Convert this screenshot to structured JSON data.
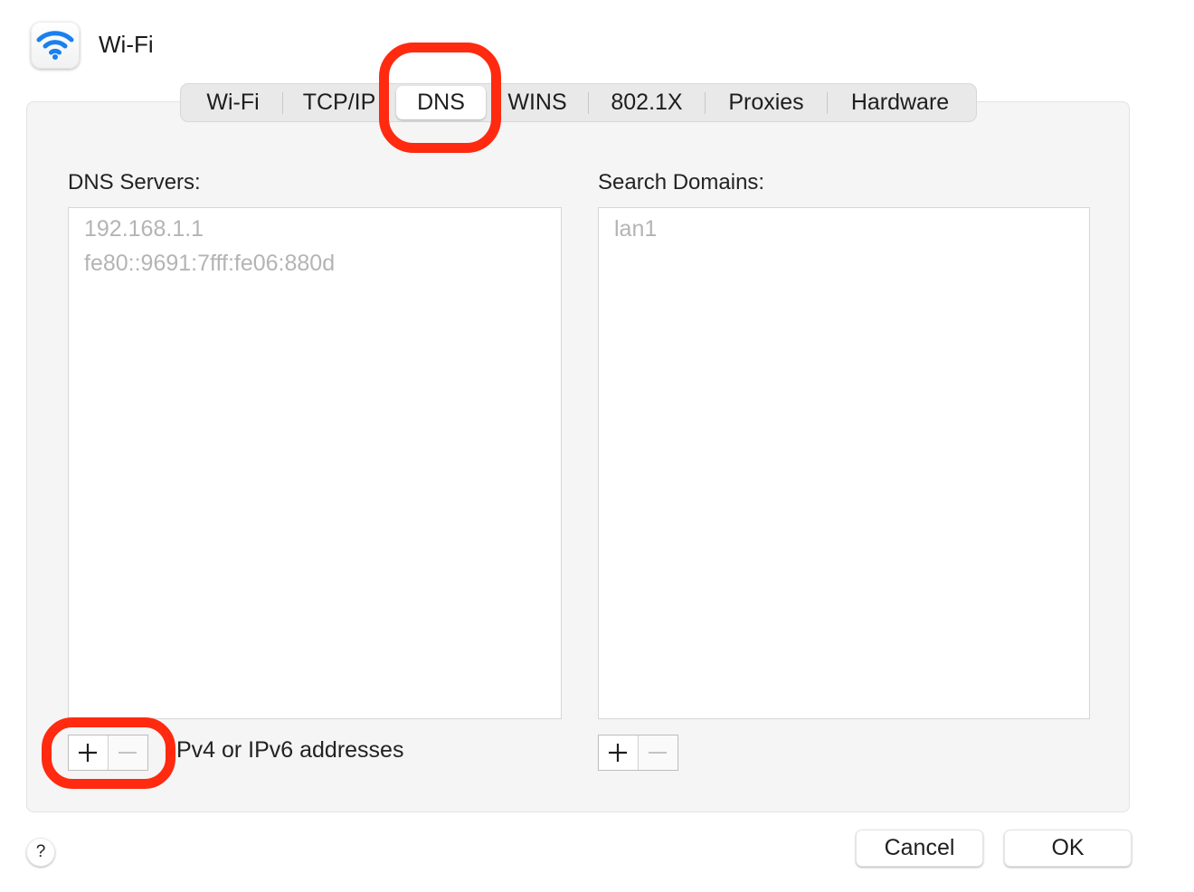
{
  "window": {
    "title": "Wi-Fi",
    "icon": "wifi-icon",
    "accent": "#1a7ff0"
  },
  "tabs": [
    {
      "label": "Wi-Fi",
      "selected": false
    },
    {
      "label": "TCP/IP",
      "selected": false
    },
    {
      "label": "DNS",
      "selected": true
    },
    {
      "label": "WINS",
      "selected": false
    },
    {
      "label": "802.1X",
      "selected": false
    },
    {
      "label": "Proxies",
      "selected": false
    },
    {
      "label": "Hardware",
      "selected": false
    }
  ],
  "dns_servers": {
    "label": "DNS Servers:",
    "items": [
      "192.168.1.1",
      "fe80::9691:7fff:fe06:880d"
    ],
    "hint": "IPv4 or IPv6 addresses",
    "add_icon": "plus-icon",
    "remove_icon": "minus-icon"
  },
  "search_domains": {
    "label": "Search Domains:",
    "items": [
      "lan1"
    ],
    "add_icon": "plus-icon",
    "remove_icon": "minus-icon"
  },
  "footer": {
    "help_label": "?",
    "cancel_label": "Cancel",
    "ok_label": "OK"
  },
  "annotations": {
    "ring_color": "#ff2a0f",
    "highlighted": [
      "tab-dns",
      "dns-servers-add-remove"
    ]
  }
}
